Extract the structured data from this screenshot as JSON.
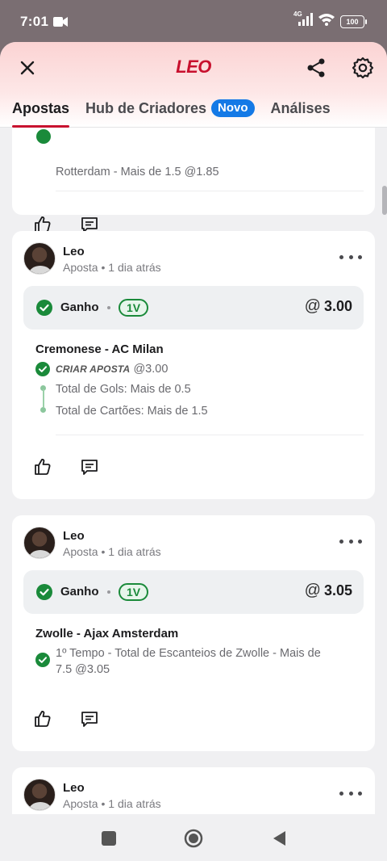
{
  "status_bar": {
    "time": "7:01",
    "network": "4G",
    "battery": "100"
  },
  "header": {
    "title": "LEO",
    "brand_color": "#c8102e"
  },
  "tabs": [
    {
      "label": "Apostas",
      "active": true
    },
    {
      "label": "Hub de Criadores",
      "badge": "Novo"
    },
    {
      "label": "Análises"
    }
  ],
  "partial_card": {
    "bet_text": "Rotterdam - Mais de 1.5 @1.85"
  },
  "posts": [
    {
      "user": "Leo",
      "meta": "Aposta • 1 dia atrás",
      "status": "Ganho",
      "tag": "1V",
      "odds_symbol": "@",
      "odds": "3.00",
      "match": "Cremonese - AC Milan",
      "criar_label": "CRIAR APOSTA",
      "criar_odds": "@3.00",
      "legs": [
        "Total de Gols: Mais de 0.5",
        "Total de Cartões: Mais de 1.5"
      ]
    },
    {
      "user": "Leo",
      "meta": "Aposta • 1 dia atrás",
      "status": "Ganho",
      "tag": "1V",
      "odds_symbol": "@",
      "odds": "3.05",
      "match": "Zwolle - Ajax Amsterdam",
      "bet_line1": "1º Tempo - Total de Escanteios de Zwolle - Mais de",
      "bet_line2": "7.5 @3.05"
    },
    {
      "user": "Leo",
      "meta": "Aposta • 1 dia atrás"
    }
  ],
  "colors": {
    "win_green": "#1a8a3a",
    "accent_blue": "#1479e6"
  }
}
